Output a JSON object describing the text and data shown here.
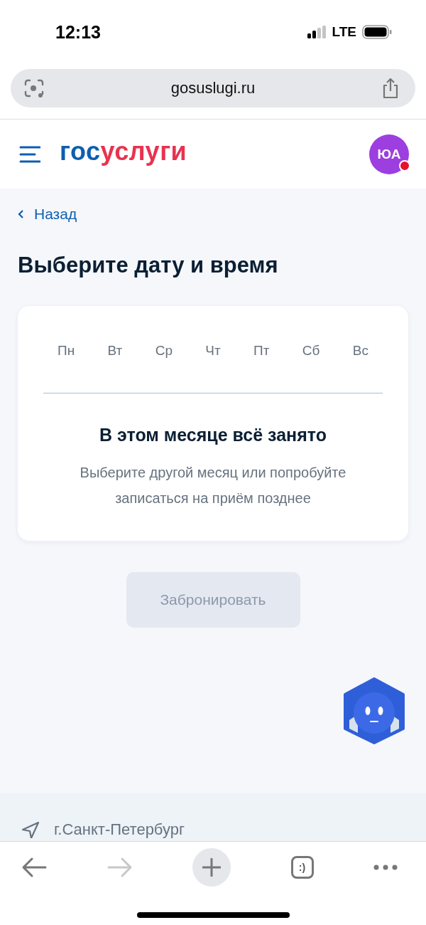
{
  "status_bar": {
    "time": "12:13",
    "network": "LTE"
  },
  "browser": {
    "url": "gosuslugi.ru"
  },
  "header": {
    "logo": [
      {
        "text": "гос",
        "kind": "primary"
      },
      {
        "text": "услуги",
        "kind": "accent"
      }
    ],
    "avatar": {
      "initials": "ЮА",
      "notification": true
    }
  },
  "back_link": "Назад",
  "title": "Выберите дату и время",
  "calendar": {
    "weekdays": [
      "Пн",
      "Вт",
      "Ср",
      "Чт",
      "Пт",
      "Сб",
      "Вс"
    ],
    "empty_title": "В этом месяце всё занято",
    "empty_text": "Выберите другой месяц или попробуйте записаться на приём позднее"
  },
  "book_button": {
    "label": "Забронировать",
    "disabled": true
  },
  "footer": {
    "location": "г.Санкт-Петербург"
  },
  "toolbar": {
    "back_disabled": false,
    "forward_disabled": true,
    "tabs_label": ":)"
  }
}
